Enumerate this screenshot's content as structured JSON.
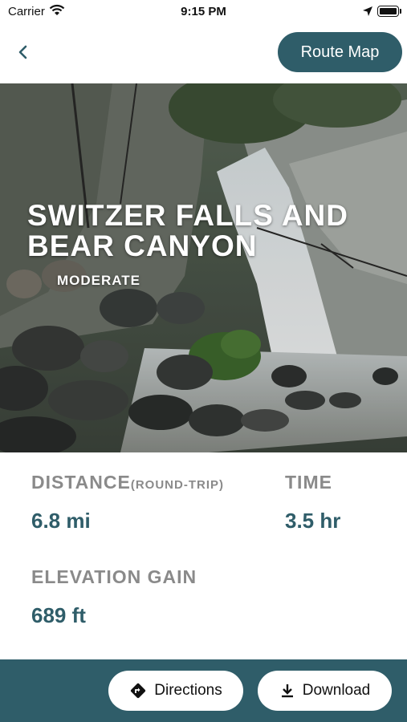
{
  "status_bar": {
    "carrier": "Carrier",
    "time": "9:15 PM"
  },
  "nav": {
    "route_map_label": "Route Map"
  },
  "hero": {
    "title": "SWITZER FALLS AND BEAR CANYON",
    "difficulty": "MODERATE"
  },
  "stats": {
    "distance_label": "DISTANCE",
    "distance_sub": "(ROUND-TRIP)",
    "distance_value": "6.8 mi",
    "time_label": "TIME",
    "time_value": "3.5 hr",
    "elevation_label": "ELEVATION GAIN",
    "elevation_value": "689 ft"
  },
  "bottom_bar": {
    "directions_label": "Directions",
    "download_label": "Download"
  },
  "colors": {
    "accent": "#2f5d69",
    "label_gray": "#8a8a8a"
  }
}
